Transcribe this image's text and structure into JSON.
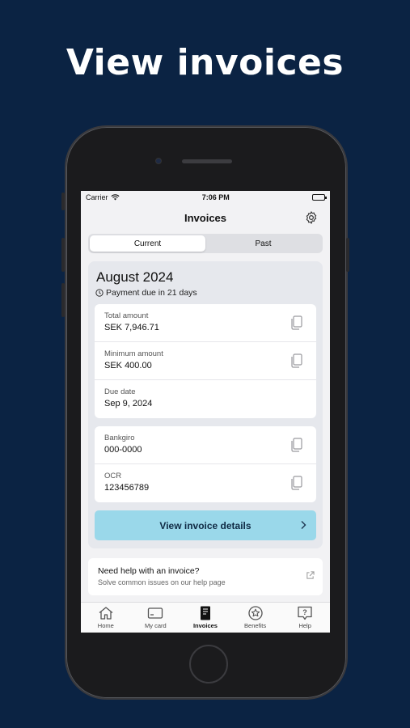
{
  "headline": "View invoices",
  "status": {
    "carrier": "Carrier",
    "time": "7:06 PM"
  },
  "nav": {
    "title": "Invoices"
  },
  "segments": [
    {
      "label": "Current",
      "active": true
    },
    {
      "label": "Past",
      "active": false
    }
  ],
  "invoice": {
    "month": "August 2024",
    "due_text": "Payment due in 21 days",
    "amounts": [
      {
        "label": "Total amount",
        "value": "SEK 7,946.71",
        "copyable": true
      },
      {
        "label": "Minimum amount",
        "value": "SEK 400.00",
        "copyable": true
      },
      {
        "label": "Due date",
        "value": "Sep 9, 2024",
        "copyable": false
      }
    ],
    "payment": [
      {
        "label": "Bankgiro",
        "value": "000-0000",
        "copyable": true
      },
      {
        "label": "OCR",
        "value": "123456789",
        "copyable": true
      }
    ],
    "cta_label": "View invoice details"
  },
  "help": {
    "title": "Need help with an invoice?",
    "subtitle": "Solve common issues on our help page"
  },
  "tabs": [
    {
      "label": "Home",
      "icon": "home-icon",
      "active": false
    },
    {
      "label": "My card",
      "icon": "card-icon",
      "active": false
    },
    {
      "label": "Invoices",
      "icon": "invoice-icon",
      "active": true
    },
    {
      "label": "Benefits",
      "icon": "star-icon",
      "active": false
    },
    {
      "label": "Help",
      "icon": "help-icon",
      "active": false
    }
  ],
  "colors": {
    "background": "#0b2343",
    "cta": "#9ad8ea",
    "cta_text": "#0f2a44"
  }
}
